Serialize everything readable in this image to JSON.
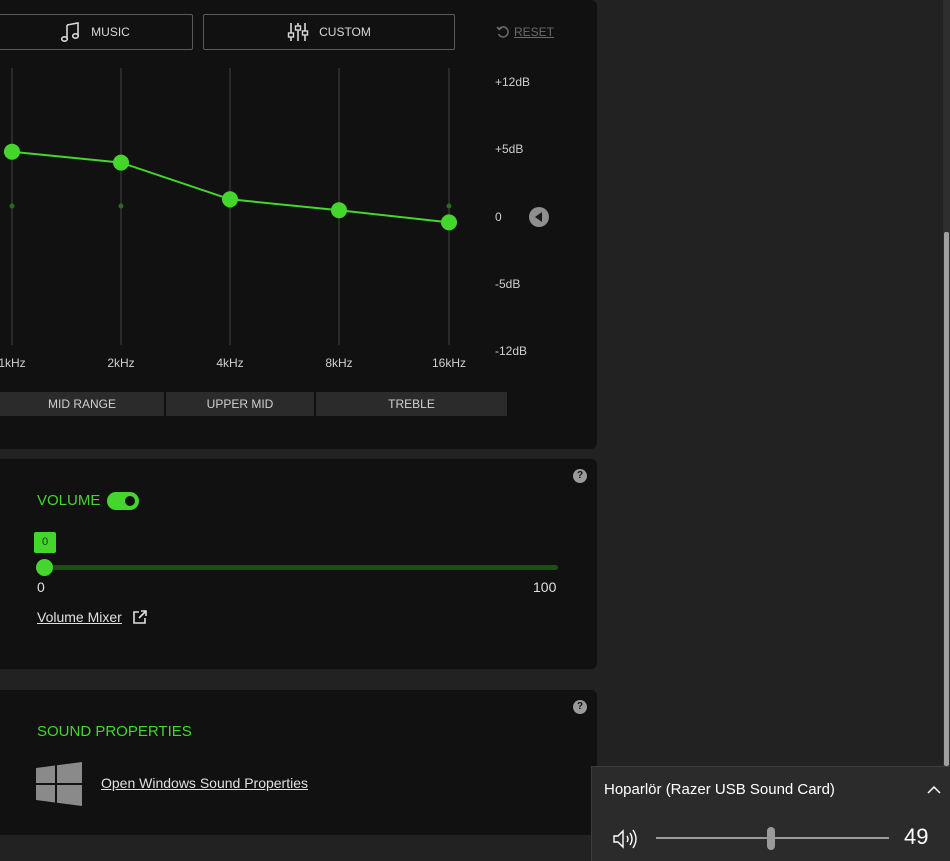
{
  "colors": {
    "accent": "#44d62c",
    "accent_dim": "#1f4d18",
    "panel": "#111111",
    "background": "#222222"
  },
  "equalizer": {
    "presets": [
      {
        "label": "MUSIC",
        "icon": "music-note-icon"
      },
      {
        "label": "CUSTOM",
        "icon": "sliders-icon"
      }
    ],
    "reset_label": "RESET",
    "db_labels": [
      "+12dB",
      "+5dB",
      "0",
      "-5dB",
      "-12dB"
    ],
    "bands": [
      {
        "freq": "1kHz",
        "gain_db": 4.8
      },
      {
        "freq": "2kHz",
        "gain_db": 4.0
      },
      {
        "freq": "4kHz",
        "gain_db": 1.3
      },
      {
        "freq": "8kHz",
        "gain_db": 0.5
      },
      {
        "freq": "16kHz",
        "gain_db": -0.4
      }
    ],
    "band_groups": [
      "MID RANGE",
      "UPPER MID",
      "TREBLE"
    ]
  },
  "volume": {
    "title": "VOLUME",
    "enabled": true,
    "value": 0,
    "value_label": "0",
    "min_label": "0",
    "max_label": "100",
    "min": 0,
    "max": 100,
    "mixer_label": "Volume Mixer",
    "help": "?"
  },
  "sound_properties": {
    "title": "SOUND PROPERTIES",
    "link_label": "Open Windows Sound Properties",
    "help": "?"
  },
  "windows_flyout": {
    "device": "Hoparlör (Razer USB Sound Card)",
    "volume": 49,
    "volume_label": "49"
  }
}
